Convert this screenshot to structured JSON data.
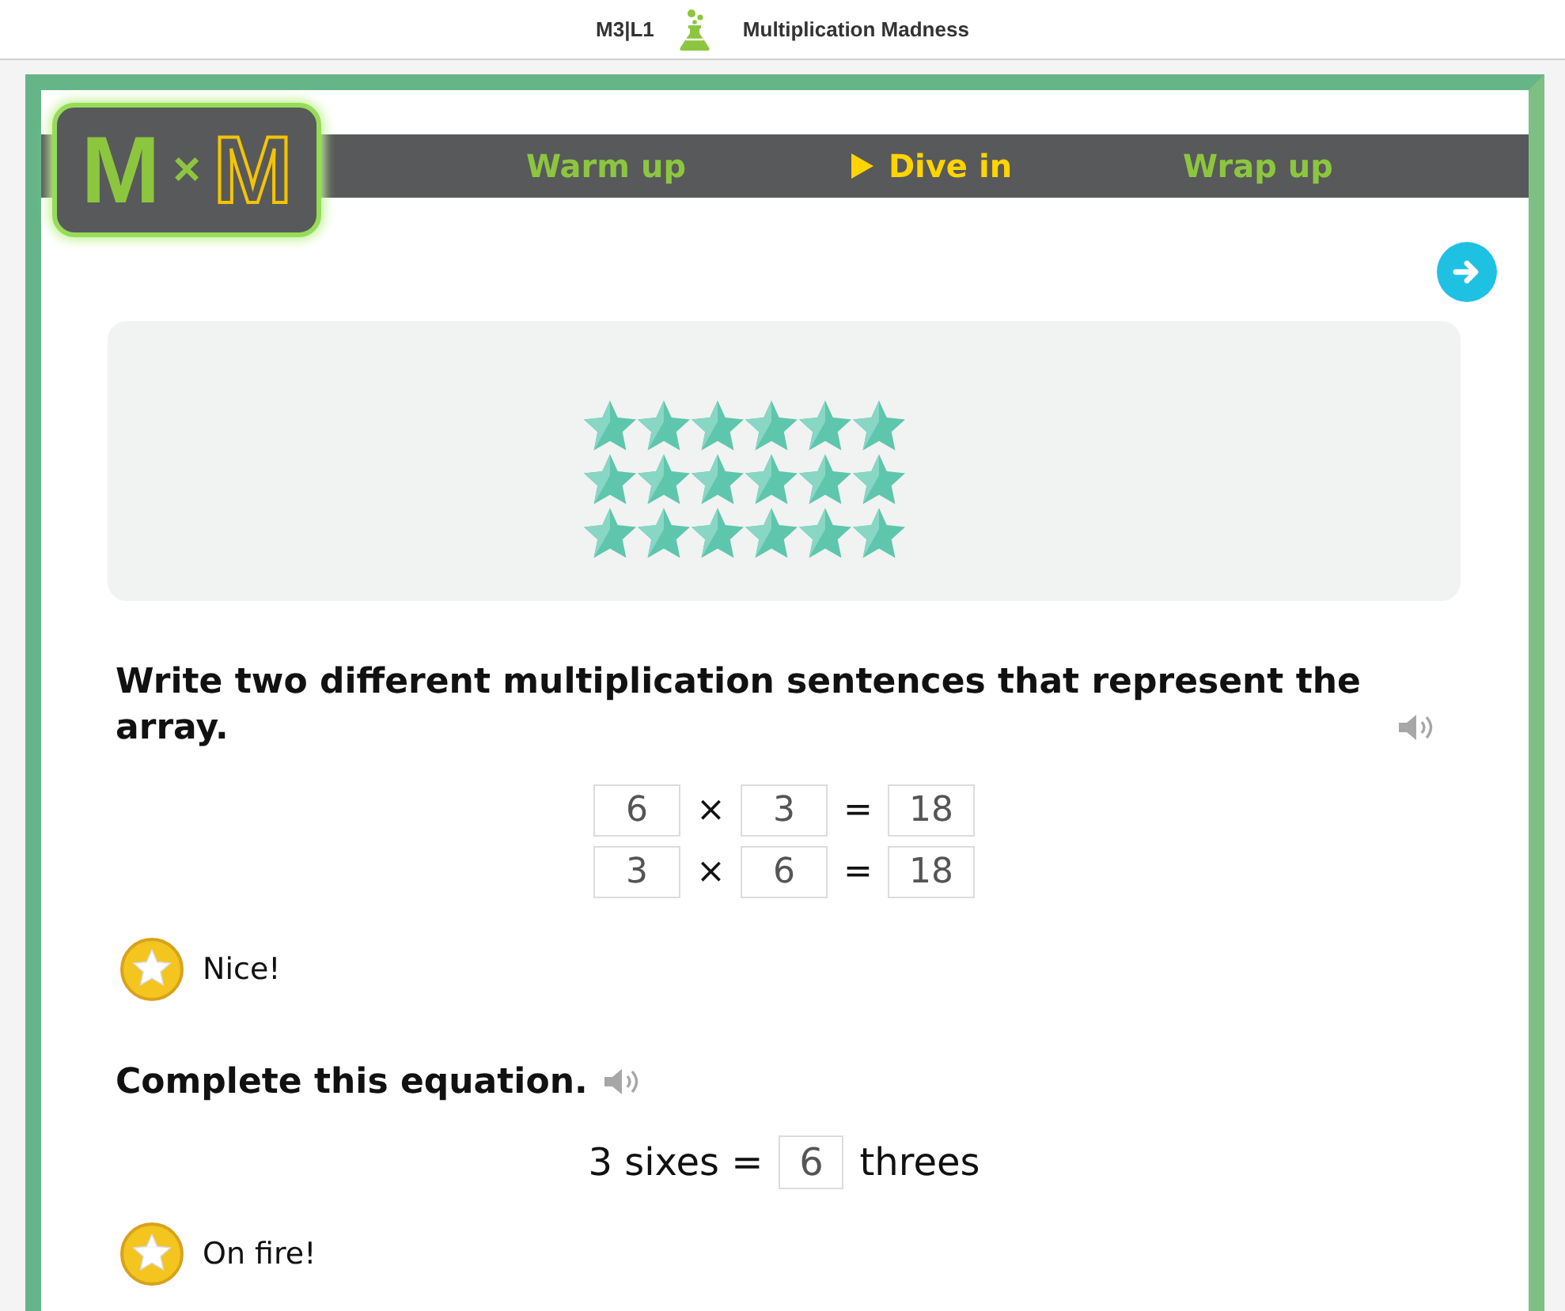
{
  "header": {
    "lesson_code": "M3|L1",
    "title": "Multiplication Madness"
  },
  "logo": {
    "left_letter": "M",
    "operator": "×",
    "right_letter": "M"
  },
  "nav": {
    "tabs": [
      {
        "label": "Warm up",
        "selected": false
      },
      {
        "label": "Dive in",
        "selected": true
      },
      {
        "label": "Wrap up",
        "selected": false
      }
    ]
  },
  "array": {
    "rows": [
      {
        "items": [
          {
            "kind": "star"
          },
          {
            "kind": "star"
          },
          {
            "kind": "star"
          },
          {
            "kind": "star"
          },
          {
            "kind": "star"
          },
          {
            "kind": "star"
          }
        ]
      },
      {
        "items": [
          {
            "kind": "star"
          },
          {
            "kind": "star"
          },
          {
            "kind": "star"
          },
          {
            "kind": "star"
          },
          {
            "kind": "star"
          },
          {
            "kind": "star"
          }
        ]
      },
      {
        "items": [
          {
            "kind": "star"
          },
          {
            "kind": "star"
          },
          {
            "kind": "star"
          },
          {
            "kind": "star"
          },
          {
            "kind": "star"
          },
          {
            "kind": "star"
          }
        ]
      }
    ]
  },
  "questions": [
    {
      "kind": "sentences",
      "prompt": "Write two different multiplication sentences that represent the array.",
      "equations": [
        {
          "parts": [
            {
              "kind": "answer",
              "value": "6"
            },
            {
              "kind": "symbol",
              "text": "×"
            },
            {
              "kind": "answer",
              "value": "3"
            },
            {
              "kind": "symbol",
              "text": "="
            },
            {
              "kind": "answer",
              "value": "18"
            }
          ]
        },
        {
          "parts": [
            {
              "kind": "answer",
              "value": "3"
            },
            {
              "kind": "symbol",
              "text": "×"
            },
            {
              "kind": "answer",
              "value": "6"
            },
            {
              "kind": "symbol",
              "text": "="
            },
            {
              "kind": "answer",
              "value": "18"
            }
          ]
        }
      ],
      "feedback": {
        "text": "Nice!"
      }
    },
    {
      "kind": "equation",
      "prompt": "Complete this equation.",
      "equations": [
        {
          "parts": [
            {
              "kind": "text",
              "text": "3 sixes ="
            },
            {
              "kind": "answer",
              "value": "6"
            },
            {
              "kind": "text",
              "text": "threes"
            }
          ]
        }
      ],
      "feedback": {
        "text": "On fire!"
      }
    }
  ]
}
